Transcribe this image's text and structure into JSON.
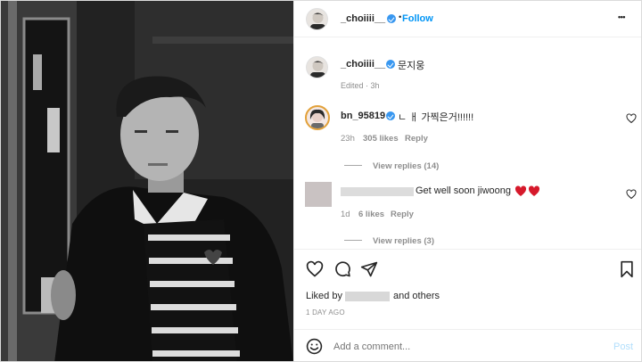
{
  "post": {
    "author": "_choiiii__",
    "follow_label": "Follow",
    "separator": "•",
    "more_label": "•••"
  },
  "caption": {
    "author": "_choiiii__",
    "text": "문지웅",
    "meta": "Edited · 3h"
  },
  "comments": [
    {
      "author": "bn_95819",
      "text": "ㄴ ㅐ 가찍은거!!!!!!",
      "time": "23h",
      "likes": "305 likes",
      "reply_label": "Reply",
      "view_replies": "View replies (14)"
    },
    {
      "author": "",
      "text": "Get well soon jiwoong",
      "time": "1d",
      "likes": "6 likes",
      "reply_label": "Reply",
      "view_replies": "View replies (3)"
    }
  ],
  "actions": {
    "liked_by_prefix": "Liked by",
    "liked_by_suffix": "and others",
    "date": "1 DAY AGO"
  },
  "composer": {
    "placeholder": "Add a comment...",
    "post_label": "Post"
  },
  "colors": {
    "accent": "#0095f6",
    "heart_red": "#ed4956",
    "verified": "#3897f0"
  }
}
